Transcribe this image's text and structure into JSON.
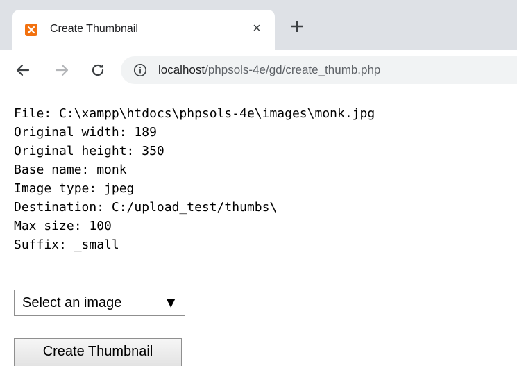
{
  "browser": {
    "tab": {
      "title": "Create Thumbnail",
      "favicon_icon": "xampp-icon",
      "close_label": "×"
    },
    "new_tab_icon": "plus-icon",
    "nav": {
      "back_icon": "arrow-left-icon",
      "forward_icon": "arrow-right-icon",
      "reload_icon": "reload-icon"
    },
    "address_bar": {
      "info_icon": "info-icon",
      "host": "localhost",
      "path": "/phpsols-4e/gd/create_thumb.php"
    }
  },
  "page": {
    "info_lines": [
      "File: C:\\xampp\\htdocs\\phpsols-4e\\images\\monk.jpg",
      "Original width: 189",
      "Original height: 350",
      "Base name: monk",
      "Image type: jpeg",
      "Destination: C:/upload_test/thumbs\\",
      "Max size: 100",
      "Suffix: _small"
    ],
    "image_select": {
      "selected": "Select an image",
      "arrow": "▼"
    },
    "create_button_label": "Create Thumbnail"
  },
  "colors": {
    "tabstrip": "#dee1e6",
    "omnibox": "#f1f3f4",
    "favicon": "#f2710f",
    "url_path": "#5f6368"
  }
}
